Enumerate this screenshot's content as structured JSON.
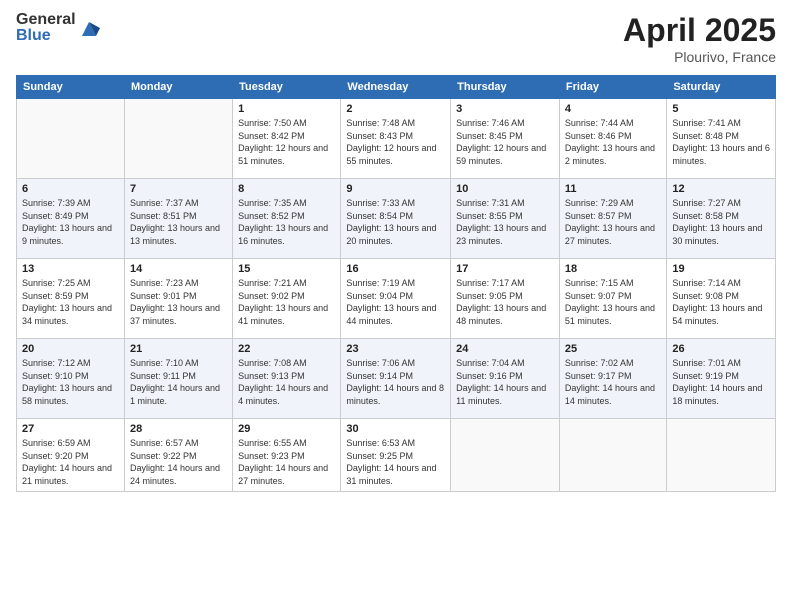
{
  "header": {
    "logo_general": "General",
    "logo_blue": "Blue",
    "title": "April 2025",
    "location": "Plourivo, France"
  },
  "days_of_week": [
    "Sunday",
    "Monday",
    "Tuesday",
    "Wednesday",
    "Thursday",
    "Friday",
    "Saturday"
  ],
  "weeks": [
    [
      {
        "day": "",
        "sunrise": "",
        "sunset": "",
        "daylight": ""
      },
      {
        "day": "",
        "sunrise": "",
        "sunset": "",
        "daylight": ""
      },
      {
        "day": "1",
        "sunrise": "Sunrise: 7:50 AM",
        "sunset": "Sunset: 8:42 PM",
        "daylight": "Daylight: 12 hours and 51 minutes."
      },
      {
        "day": "2",
        "sunrise": "Sunrise: 7:48 AM",
        "sunset": "Sunset: 8:43 PM",
        "daylight": "Daylight: 12 hours and 55 minutes."
      },
      {
        "day": "3",
        "sunrise": "Sunrise: 7:46 AM",
        "sunset": "Sunset: 8:45 PM",
        "daylight": "Daylight: 12 hours and 59 minutes."
      },
      {
        "day": "4",
        "sunrise": "Sunrise: 7:44 AM",
        "sunset": "Sunset: 8:46 PM",
        "daylight": "Daylight: 13 hours and 2 minutes."
      },
      {
        "day": "5",
        "sunrise": "Sunrise: 7:41 AM",
        "sunset": "Sunset: 8:48 PM",
        "daylight": "Daylight: 13 hours and 6 minutes."
      }
    ],
    [
      {
        "day": "6",
        "sunrise": "Sunrise: 7:39 AM",
        "sunset": "Sunset: 8:49 PM",
        "daylight": "Daylight: 13 hours and 9 minutes."
      },
      {
        "day": "7",
        "sunrise": "Sunrise: 7:37 AM",
        "sunset": "Sunset: 8:51 PM",
        "daylight": "Daylight: 13 hours and 13 minutes."
      },
      {
        "day": "8",
        "sunrise": "Sunrise: 7:35 AM",
        "sunset": "Sunset: 8:52 PM",
        "daylight": "Daylight: 13 hours and 16 minutes."
      },
      {
        "day": "9",
        "sunrise": "Sunrise: 7:33 AM",
        "sunset": "Sunset: 8:54 PM",
        "daylight": "Daylight: 13 hours and 20 minutes."
      },
      {
        "day": "10",
        "sunrise": "Sunrise: 7:31 AM",
        "sunset": "Sunset: 8:55 PM",
        "daylight": "Daylight: 13 hours and 23 minutes."
      },
      {
        "day": "11",
        "sunrise": "Sunrise: 7:29 AM",
        "sunset": "Sunset: 8:57 PM",
        "daylight": "Daylight: 13 hours and 27 minutes."
      },
      {
        "day": "12",
        "sunrise": "Sunrise: 7:27 AM",
        "sunset": "Sunset: 8:58 PM",
        "daylight": "Daylight: 13 hours and 30 minutes."
      }
    ],
    [
      {
        "day": "13",
        "sunrise": "Sunrise: 7:25 AM",
        "sunset": "Sunset: 8:59 PM",
        "daylight": "Daylight: 13 hours and 34 minutes."
      },
      {
        "day": "14",
        "sunrise": "Sunrise: 7:23 AM",
        "sunset": "Sunset: 9:01 PM",
        "daylight": "Daylight: 13 hours and 37 minutes."
      },
      {
        "day": "15",
        "sunrise": "Sunrise: 7:21 AM",
        "sunset": "Sunset: 9:02 PM",
        "daylight": "Daylight: 13 hours and 41 minutes."
      },
      {
        "day": "16",
        "sunrise": "Sunrise: 7:19 AM",
        "sunset": "Sunset: 9:04 PM",
        "daylight": "Daylight: 13 hours and 44 minutes."
      },
      {
        "day": "17",
        "sunrise": "Sunrise: 7:17 AM",
        "sunset": "Sunset: 9:05 PM",
        "daylight": "Daylight: 13 hours and 48 minutes."
      },
      {
        "day": "18",
        "sunrise": "Sunrise: 7:15 AM",
        "sunset": "Sunset: 9:07 PM",
        "daylight": "Daylight: 13 hours and 51 minutes."
      },
      {
        "day": "19",
        "sunrise": "Sunrise: 7:14 AM",
        "sunset": "Sunset: 9:08 PM",
        "daylight": "Daylight: 13 hours and 54 minutes."
      }
    ],
    [
      {
        "day": "20",
        "sunrise": "Sunrise: 7:12 AM",
        "sunset": "Sunset: 9:10 PM",
        "daylight": "Daylight: 13 hours and 58 minutes."
      },
      {
        "day": "21",
        "sunrise": "Sunrise: 7:10 AM",
        "sunset": "Sunset: 9:11 PM",
        "daylight": "Daylight: 14 hours and 1 minute."
      },
      {
        "day": "22",
        "sunrise": "Sunrise: 7:08 AM",
        "sunset": "Sunset: 9:13 PM",
        "daylight": "Daylight: 14 hours and 4 minutes."
      },
      {
        "day": "23",
        "sunrise": "Sunrise: 7:06 AM",
        "sunset": "Sunset: 9:14 PM",
        "daylight": "Daylight: 14 hours and 8 minutes."
      },
      {
        "day": "24",
        "sunrise": "Sunrise: 7:04 AM",
        "sunset": "Sunset: 9:16 PM",
        "daylight": "Daylight: 14 hours and 11 minutes."
      },
      {
        "day": "25",
        "sunrise": "Sunrise: 7:02 AM",
        "sunset": "Sunset: 9:17 PM",
        "daylight": "Daylight: 14 hours and 14 minutes."
      },
      {
        "day": "26",
        "sunrise": "Sunrise: 7:01 AM",
        "sunset": "Sunset: 9:19 PM",
        "daylight": "Daylight: 14 hours and 18 minutes."
      }
    ],
    [
      {
        "day": "27",
        "sunrise": "Sunrise: 6:59 AM",
        "sunset": "Sunset: 9:20 PM",
        "daylight": "Daylight: 14 hours and 21 minutes."
      },
      {
        "day": "28",
        "sunrise": "Sunrise: 6:57 AM",
        "sunset": "Sunset: 9:22 PM",
        "daylight": "Daylight: 14 hours and 24 minutes."
      },
      {
        "day": "29",
        "sunrise": "Sunrise: 6:55 AM",
        "sunset": "Sunset: 9:23 PM",
        "daylight": "Daylight: 14 hours and 27 minutes."
      },
      {
        "day": "30",
        "sunrise": "Sunrise: 6:53 AM",
        "sunset": "Sunset: 9:25 PM",
        "daylight": "Daylight: 14 hours and 31 minutes."
      },
      {
        "day": "",
        "sunrise": "",
        "sunset": "",
        "daylight": ""
      },
      {
        "day": "",
        "sunrise": "",
        "sunset": "",
        "daylight": ""
      },
      {
        "day": "",
        "sunrise": "",
        "sunset": "",
        "daylight": ""
      }
    ]
  ]
}
